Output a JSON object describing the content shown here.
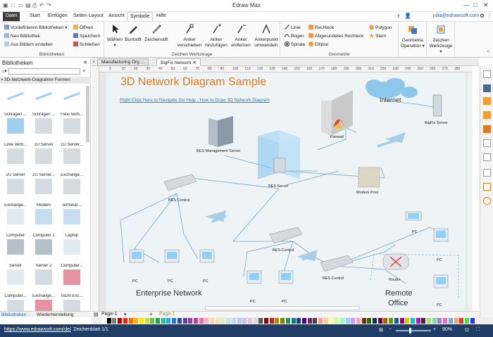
{
  "app": {
    "title": "Edraw Max",
    "user": "julia@edrawsoft.com"
  },
  "menu": {
    "tabs": [
      "Datei",
      "Start",
      "Einfügen",
      "Seiten Layout",
      "Ansicht",
      "Symbole",
      "Hilfe"
    ],
    "active": "Symbole"
  },
  "ribbon": {
    "libraries": {
      "items": [
        "Vordefinieren Bibliotheken",
        "Neu Bibliothek",
        "Aus Bildern erstellen"
      ],
      "open": "Öffnen",
      "save": "Speichern",
      "close": "Schließen",
      "label": "Bibliotheken"
    },
    "drawing_tools": {
      "select": "Wählen",
      "pen": "Buntstift",
      "pencil": "Zeichenstift",
      "move_anchor": "Anker verschieben",
      "add_anchor": "Anker hinzufügen",
      "remove_anchor": "Anker entfernen",
      "convert_anchor": "Ankerpunkt umwandeln",
      "label": "Zeichen Werkzeuge"
    },
    "geometry": {
      "line": "Linie",
      "arc": "Bogen",
      "spiral": "Spirale",
      "rect": "Rechteck",
      "rounded_rect": "Abgerundetes Rechteck",
      "ellipse": "Ellipse",
      "polygon": "Polygon",
      "star": "Stern",
      "label": "Geometrie"
    },
    "geometry_ops": {
      "label1": "Geometrie",
      "label2": "Operation"
    },
    "draw_tools": {
      "label1": "Zeichen",
      "label2": "Werkzeuge"
    }
  },
  "sidebar": {
    "title": "Bibliotheken",
    "category": "3D-Netzwerk-Diagramm Formen",
    "shapes": [
      "Schrägen ...",
      "Schrägen ...",
      "Flexi Verb...",
      "Linie Verb...",
      "1U Server",
      "1U Server...",
      "2U Server",
      "2U Server...",
      "Exchange...",
      "Exchange...",
      "Modem",
      "Terminal ...",
      "Computer",
      "Computer 2",
      "Laptop",
      "Server",
      "Server 2",
      "Computer...",
      "Computer...",
      "Exchange...",
      "ISDN Exc...",
      "",
      "",
      ""
    ],
    "bottom_tabs": [
      "Bibliotheken",
      "Wiederherstellung"
    ]
  },
  "doc_tabs": [
    "Manufacturing Org ...",
    "BigFix Network"
  ],
  "active_doc": "BigFix Network",
  "ruler": {
    "ticks": [
      "0",
      "10",
      "20",
      "30",
      "40",
      "50",
      "60",
      "70",
      "80",
      "90",
      "100",
      "110",
      "120",
      "130",
      "140",
      "150",
      "160",
      "170",
      "180",
      "190",
      "200",
      "210",
      "220",
      "230",
      "240",
      "250",
      "260",
      "270",
      "280"
    ]
  },
  "diagram": {
    "title": "3D Network Diagram Sample",
    "link": "Right Click Here to Navigate the Help - How to Draw 3D Network Diagram",
    "labels": {
      "internet": "Internet",
      "firewall": "Firewall",
      "bigfix_server": "BigFix Server",
      "bes_mgmt": "BES Management Server",
      "bes_server": "BES Server",
      "modem_pool": "Modem Pool",
      "bes_control1": "BES Control",
      "bes_control2": "BES Control",
      "bes_control3": "BES Control",
      "router": "Router",
      "pc": "PC",
      "enterprise": "Enterprise Network",
      "remote1": "Remote",
      "remote2": "Office"
    }
  },
  "page_tabs": {
    "page1": "Page-1",
    "page1_active": "Page-1"
  },
  "status": {
    "url": "https://www.edrawsoft.com/de/",
    "sheet": "Zeichenblatt 1/1",
    "zoom": "90%"
  },
  "colors": {
    "accent": "#e07a1f",
    "status": "#1f3d66",
    "link": "#2d7db3"
  }
}
